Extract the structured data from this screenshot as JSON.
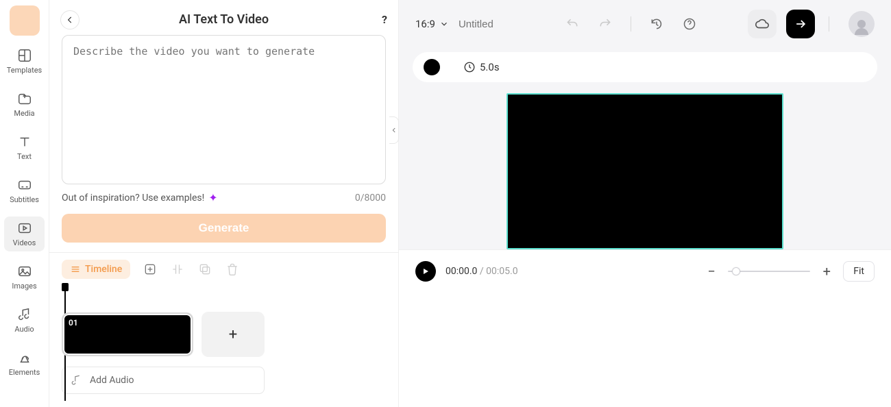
{
  "sidebar": {
    "items": [
      {
        "label": "Templates"
      },
      {
        "label": "Media"
      },
      {
        "label": "Text"
      },
      {
        "label": "Subtitles"
      },
      {
        "label": "Videos"
      },
      {
        "label": "Images"
      },
      {
        "label": "Audio"
      },
      {
        "label": "Elements"
      }
    ]
  },
  "leftPanel": {
    "title": "AI Text To Video",
    "help": "?",
    "promptPlaceholder": "Describe the video you want to generate",
    "promptValue": "",
    "inspiration": "Out of inspiration? Use examples!",
    "counter": "0/8000",
    "generateLabel": "Generate"
  },
  "timeline": {
    "chipLabel": "Timeline",
    "clipNumber": "01",
    "addAudio": "Add Audio"
  },
  "rightPanel": {
    "aspect": "16:9",
    "projectPlaceholder": "Untitled",
    "sceneDuration": "5.0s",
    "currentTime": "00:00.0",
    "totalTime": "00:05.0",
    "fitLabel": "Fit"
  }
}
